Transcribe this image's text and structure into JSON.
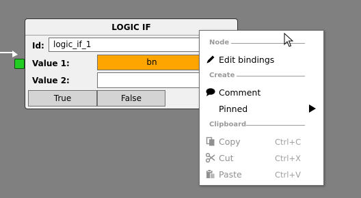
{
  "node": {
    "title": "LOGIC IF",
    "id_label": "Id:",
    "id_value": "logic_if_1",
    "value1_label": "Value 1:",
    "value1_value": "bn",
    "value2_label": "Value 2:",
    "value2_value": "",
    "true_button": "True",
    "false_button": "False"
  },
  "context_menu": {
    "sections": {
      "node": "Node",
      "create": "Create",
      "clipboard": "Clipboard"
    },
    "items": {
      "edit_bindings": "Edit bindings",
      "comment": "Comment",
      "pinned": "Pinned",
      "copy": "Copy",
      "copy_shortcut": "Ctrl+C",
      "cut": "Cut",
      "cut_shortcut": "Ctrl+X",
      "paste": "Paste",
      "paste_shortcut": "Ctrl+V"
    }
  },
  "icons": {
    "edit_bindings": "pencil-icon",
    "comment": "speech-bubble-icon",
    "pinned_submenu": "triangle-right-icon",
    "copy": "copy-icon",
    "cut": "scissors-icon",
    "paste": "paste-icon"
  },
  "colors": {
    "canvas": "#808080",
    "node_body": "#f0f0f0",
    "value1_fill": "#ffa500",
    "input_pin": "#22cc22",
    "menu_bg": "#ffffff",
    "disabled_text": "#909090"
  }
}
